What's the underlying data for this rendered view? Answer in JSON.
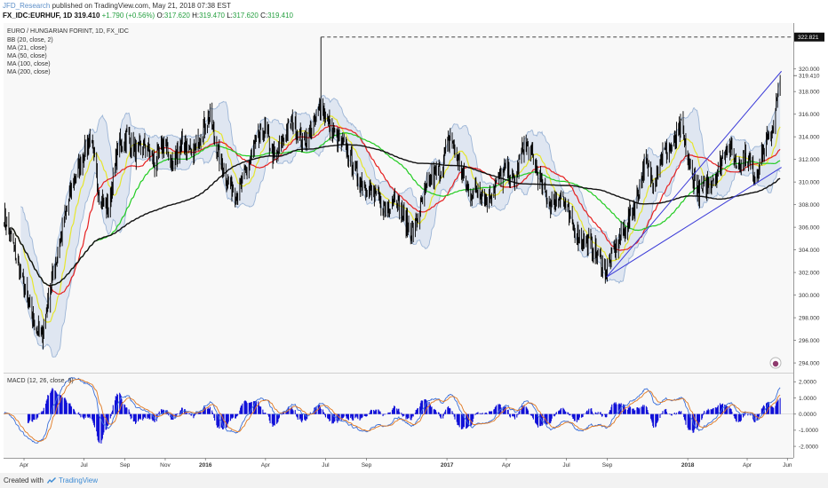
{
  "header": {
    "author": "JFD_Research",
    "published_text": "published on TradingView.com, May 21, 2018 07:38 EST",
    "symbol": "FX_IDC:EURHUF, 1D",
    "last": "319.410",
    "change": "+1.790 (+0.56%)",
    "ohlc": {
      "o_label": "O:",
      "o": "317.620",
      "h_label": "H:",
      "h": "319.470",
      "l_label": "L:",
      "l": "317.620",
      "c_label": "C:",
      "c": "319.410"
    }
  },
  "legend": {
    "title": "EURO / HUNGARIAN FORINT, 1D, FX_IDC",
    "items": [
      "BB (20, close, 2)",
      "MA (21, close)",
      "MA (50, close)",
      "MA (100, close)",
      "MA (200, close)"
    ]
  },
  "macd_legend": "MACD (12, 26, close, 9)",
  "footer": {
    "created_with": "Created with",
    "brand": "TradingView"
  },
  "colors": {
    "candle": "#000000",
    "bb": "#9cb5d6",
    "bb_fill": "#dfe6f1",
    "ma21": "#e6e62e",
    "ma50": "#e62020",
    "ma100": "#22cc22",
    "ma200": "#111111",
    "trendline": "#3b3bd8",
    "macd_line": "#3b6fd8",
    "signal_line": "#e07820",
    "histogram": "#1010d8",
    "price_label_bg": "#111111"
  },
  "chart_data": {
    "type": "candlestick",
    "instrument": "EURHUF",
    "x_axis": {
      "ticks": [
        "Apr",
        "Jul",
        "Sep",
        "Nov",
        "2016",
        "Apr",
        "Jul",
        "Sep",
        "2017",
        "Apr",
        "Jul",
        "Sep",
        "2018",
        "Apr",
        "Jun"
      ],
      "tick_dates": [
        "2015-04-01",
        "2015-07-01",
        "2015-09-01",
        "2015-11-01",
        "2016-01-01",
        "2016-04-01",
        "2016-07-01",
        "2016-09-01",
        "2017-01-01",
        "2017-04-01",
        "2017-07-01",
        "2017-09-01",
        "2018-01-01",
        "2018-04-01",
        "2018-06-01"
      ],
      "range": [
        "2015-03-01",
        "2018-06-10"
      ]
    },
    "price_axis": {
      "ticks": [
        "294.000",
        "296.000",
        "298.000",
        "300.000",
        "302.000",
        "304.000",
        "306.000",
        "308.000",
        "310.000",
        "312.000",
        "314.000",
        "316.000",
        "318.000",
        "320.000"
      ],
      "range": [
        293.3,
        323.9
      ],
      "last_price": "319.410",
      "marked_high": "322.821"
    },
    "macd_axis": {
      "ticks": [
        "2.0000",
        "1.0000",
        "0.0000",
        "-1.0000",
        "-2.0000"
      ],
      "range": [
        -2.6,
        2.4
      ]
    },
    "price_path": [
      [
        "2015-03-02",
        307.0
      ],
      [
        "2015-03-20",
        303.5
      ],
      [
        "2015-04-10",
        298.5
      ],
      [
        "2015-04-28",
        296.2
      ],
      [
        "2015-05-12",
        301.0
      ],
      [
        "2015-05-28",
        305.5
      ],
      [
        "2015-06-12",
        309.5
      ],
      [
        "2015-06-30",
        312.5
      ],
      [
        "2015-07-10",
        314.0
      ],
      [
        "2015-07-24",
        309.0
      ],
      [
        "2015-08-07",
        307.5
      ],
      [
        "2015-08-21",
        313.0
      ],
      [
        "2015-09-04",
        314.2
      ],
      [
        "2015-09-18",
        312.5
      ],
      [
        "2015-10-02",
        313.2
      ],
      [
        "2015-10-16",
        311.5
      ],
      [
        "2015-10-30",
        313.5
      ],
      [
        "2015-11-13",
        311.5
      ],
      [
        "2015-11-27",
        313.8
      ],
      [
        "2015-12-11",
        312.0
      ],
      [
        "2015-12-25",
        314.5
      ],
      [
        "2016-01-08",
        315.8
      ],
      [
        "2016-01-22",
        312.0
      ],
      [
        "2016-02-05",
        310.0
      ],
      [
        "2016-02-19",
        309.0
      ],
      [
        "2016-03-04",
        311.0
      ],
      [
        "2016-03-18",
        313.5
      ],
      [
        "2016-04-01",
        314.5
      ],
      [
        "2016-04-15",
        312.0
      ],
      [
        "2016-04-29",
        314.0
      ],
      [
        "2016-05-13",
        315.5
      ],
      [
        "2016-05-27",
        313.5
      ],
      [
        "2016-06-10",
        314.5
      ],
      [
        "2016-06-24",
        317.0
      ],
      [
        "2016-07-08",
        314.8
      ],
      [
        "2016-07-22",
        313.5
      ],
      [
        "2016-08-05",
        312.5
      ],
      [
        "2016-08-19",
        310.5
      ],
      [
        "2016-09-02",
        309.5
      ],
      [
        "2016-09-16",
        308.5
      ],
      [
        "2016-09-30",
        307.5
      ],
      [
        "2016-10-14",
        309.0
      ],
      [
        "2016-10-28",
        306.5
      ],
      [
        "2016-11-11",
        305.5
      ],
      [
        "2016-11-25",
        308.5
      ],
      [
        "2016-12-09",
        310.5
      ],
      [
        "2016-12-23",
        311.0
      ],
      [
        "2017-01-06",
        314.2
      ],
      [
        "2017-01-20",
        311.5
      ],
      [
        "2017-02-03",
        309.0
      ],
      [
        "2017-02-17",
        309.5
      ],
      [
        "2017-03-03",
        308.5
      ],
      [
        "2017-03-17",
        309.8
      ],
      [
        "2017-03-31",
        311.0
      ],
      [
        "2017-04-14",
        310.0
      ],
      [
        "2017-04-28",
        313.5
      ],
      [
        "2017-05-12",
        312.0
      ],
      [
        "2017-05-26",
        309.5
      ],
      [
        "2017-06-09",
        308.0
      ],
      [
        "2017-06-23",
        309.0
      ],
      [
        "2017-07-07",
        306.5
      ],
      [
        "2017-07-21",
        305.0
      ],
      [
        "2017-08-04",
        304.5
      ],
      [
        "2017-08-18",
        303.5
      ],
      [
        "2017-08-31",
        302.0
      ],
      [
        "2017-09-15",
        304.5
      ],
      [
        "2017-09-29",
        306.0
      ],
      [
        "2017-10-13",
        308.0
      ],
      [
        "2017-10-27",
        311.5
      ],
      [
        "2017-11-10",
        310.0
      ],
      [
        "2017-11-24",
        312.5
      ],
      [
        "2017-12-08",
        313.0
      ],
      [
        "2017-12-22",
        314.8
      ],
      [
        "2018-01-05",
        311.0
      ],
      [
        "2018-01-19",
        309.0
      ],
      [
        "2018-02-02",
        310.0
      ],
      [
        "2018-02-16",
        311.0
      ],
      [
        "2018-03-02",
        313.5
      ],
      [
        "2018-03-16",
        311.5
      ],
      [
        "2018-03-30",
        312.5
      ],
      [
        "2018-04-13",
        310.5
      ],
      [
        "2018-04-27",
        313.0
      ],
      [
        "2018-05-08",
        314.5
      ],
      [
        "2018-05-16",
        317.0
      ],
      [
        "2018-05-21",
        319.41
      ]
    ],
    "marked_high_date": "2016-06-24",
    "trendlines": [
      {
        "from": [
          "2017-08-31",
          301.6
        ],
        "to": [
          "2018-05-23",
          319.8
        ]
      },
      {
        "from": [
          "2017-08-31",
          301.6
        ],
        "to": [
          "2018-05-23",
          311.3
        ]
      }
    ]
  }
}
